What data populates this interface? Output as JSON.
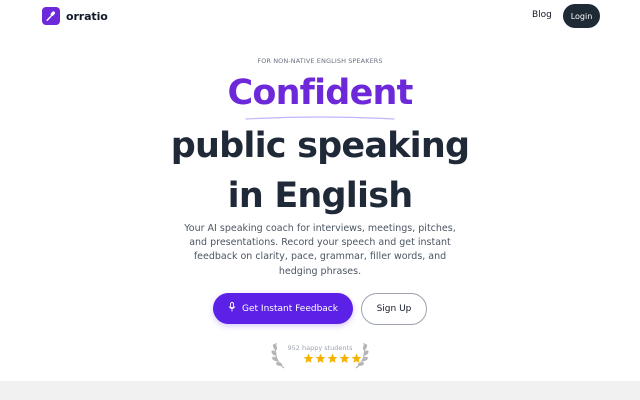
{
  "brand": {
    "name": "orratio",
    "accent": "#6d28d9"
  },
  "nav": {
    "blog": "Blog",
    "login": "Login"
  },
  "hero": {
    "eyebrow": "FOR NON-NATIVE ENGLISH SPEAKERS",
    "headline_accent": "Confident",
    "headline_line1": "public speaking",
    "headline_line2": "in English",
    "description": "Your AI speaking coach for interviews, meetings, pitches, and presentations. Record your speech and get instant feedback on clarity, pace, grammar, filler words, and hedging phrases."
  },
  "cta": {
    "primary_label": "Get Instant Feedback",
    "primary_icon": "microphone-icon",
    "secondary_label": "Sign Up"
  },
  "social_proof": {
    "text": "952 happy students",
    "rating": 5,
    "star_color": "#f5b301"
  }
}
